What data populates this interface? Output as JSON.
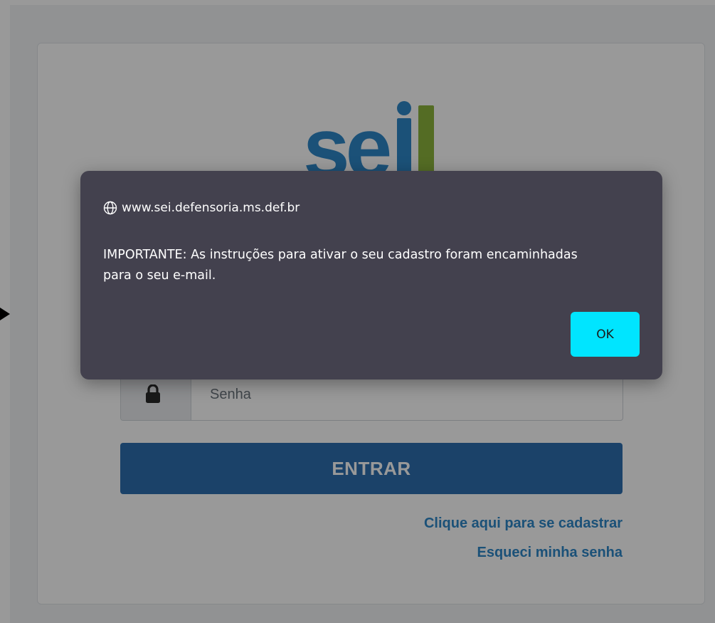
{
  "login": {
    "logo_text": "sei!",
    "password_placeholder": "Senha",
    "submit_label": "ENTRAR",
    "register_link": "Clique aqui para se cadastrar",
    "forgot_link": "Esqueci minha senha"
  },
  "dialog": {
    "origin": "www.sei.defensoria.ms.def.br",
    "message": "IMPORTANTE: As instruções para ativar o seu cadastro foram encaminhadas para o seu e-mail.",
    "ok_label": "OK"
  },
  "icons": {
    "globe": "globe-icon",
    "lock": "lock-icon",
    "arrow": "arrow-right-icon"
  },
  "colors": {
    "brand_blue": "#2e87c8",
    "brand_green": "#8cb43c",
    "button_blue": "#2e6fb0",
    "dialog_bg": "#43414e",
    "ok_button": "#00e5ff"
  }
}
